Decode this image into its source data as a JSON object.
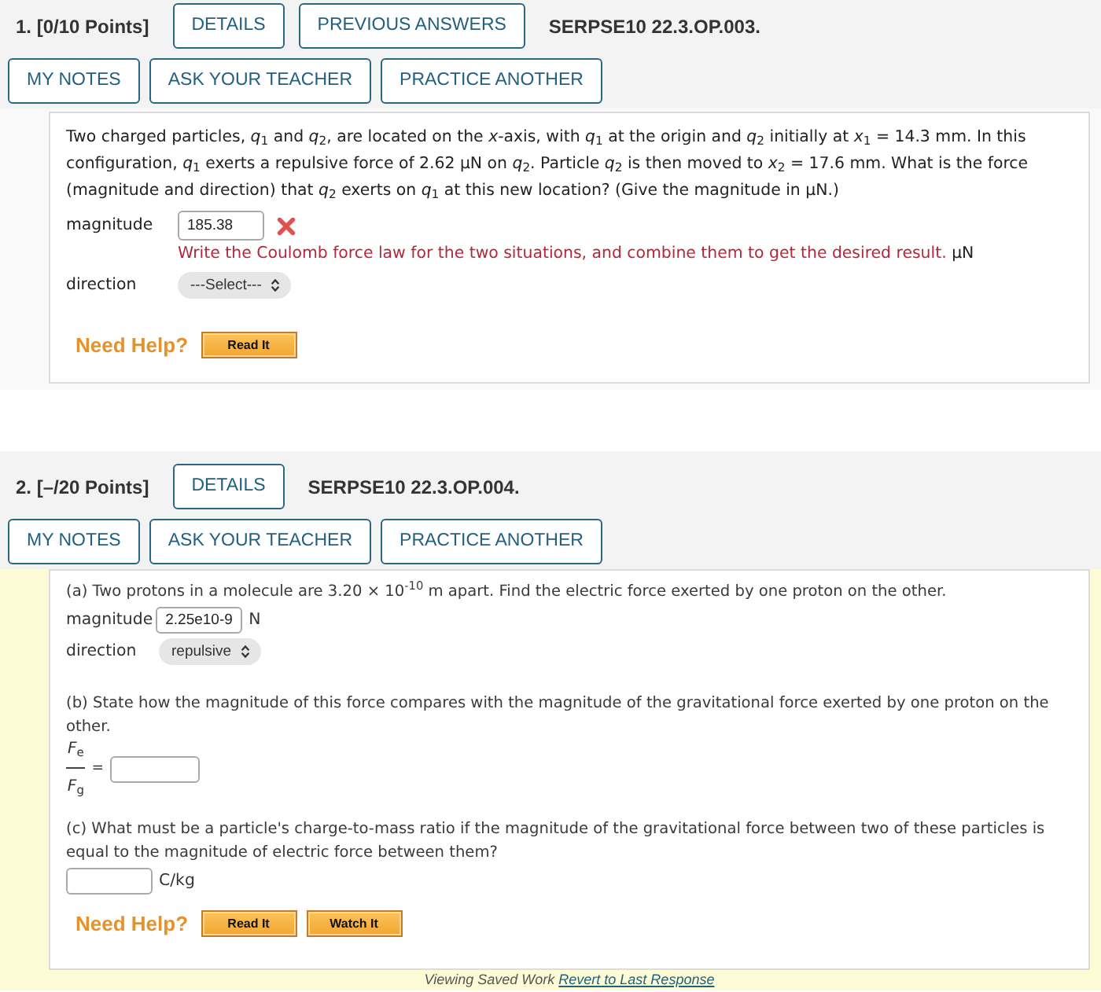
{
  "questions": [
    {
      "number": "1.",
      "points": "[0/10 Points]",
      "header_buttons": [
        "DETAILS",
        "PREVIOUS ANSWERS"
      ],
      "code": "SERPSE10 22.3.OP.003.",
      "tool_buttons": [
        "MY NOTES",
        "ASK YOUR TEACHER",
        "PRACTICE ANOTHER"
      ],
      "viewing_saved_work": false,
      "body": [
        {
          "kind": "text",
          "text": "Two charged particles, *q*$_{1}$ and *q*$_{2}$, are located on the *x*-axis, with *q*$_{1}$ at the origin and *q*$_{2}$ initially at *x*$_{1}$ = 14.3 mm. In this configuration, *q*$_{1}$ exerts a repulsive force of 2.62 μN on *q*$_{2}$. Particle *q*$_{2}$ is then moved to *x*$_{2}$ = 17.6 mm. What is the force (magnitude and direction) that *q*$_{2}$ exerts on *q*$_{1}$ at this new location? (Give the magnitude in μN.)"
        },
        {
          "kind": "answer",
          "label": "magnitude",
          "value": "185.38",
          "correct": false,
          "hint": "Write the Coulomb force law for the two situations, and combine them to get the desired result.",
          "unit": "μN"
        },
        {
          "kind": "choice",
          "label": "direction",
          "value": "---Select---"
        },
        {
          "kind": "help",
          "label": "Need Help?",
          "buttons": [
            "Read It"
          ]
        }
      ]
    },
    {
      "number": "2.",
      "points": "[–/20 Points]",
      "header_buttons": [
        "DETAILS"
      ],
      "code": "SERPSE10 22.3.OP.004.",
      "tool_buttons": [
        "MY NOTES",
        "ASK YOUR TEACHER",
        "PRACTICE ANOTHER"
      ],
      "viewing_saved_work": true,
      "body": [
        {
          "kind": "part",
          "text": "(a) Two protons in a molecule are 3.20 × 10$^{-10}$ m apart. Find the electric force exerted by one proton on the other."
        },
        {
          "kind": "inline_answer",
          "label": "magnitude",
          "value": "2.25e10-9",
          "unit": "N"
        },
        {
          "kind": "inline_choice",
          "label": "direction",
          "value": "repulsive"
        },
        {
          "kind": "part",
          "text": "(b) State how the magnitude of this force compares with the magnitude of the gravitational force exerted by one proton on the other."
        },
        {
          "kind": "ratio_answer",
          "numerator": "*F*$_{e}$",
          "denominator": "*F*$_{g}$",
          "sign": "="
        },
        {
          "kind": "part",
          "text": "(c) What must be a particle's charge-to-mass ratio if the magnitude of the gravitational force between two of these particles is equal to the magnitude of electric force between them?"
        },
        {
          "kind": "inline_answer",
          "unit": "C/kg"
        },
        {
          "kind": "help",
          "label": "Need Help?",
          "buttons": [
            "Read It",
            "Watch It"
          ]
        }
      ],
      "footer": {
        "text": "Viewing Saved Work",
        "link": "Revert to Last Response"
      }
    }
  ]
}
